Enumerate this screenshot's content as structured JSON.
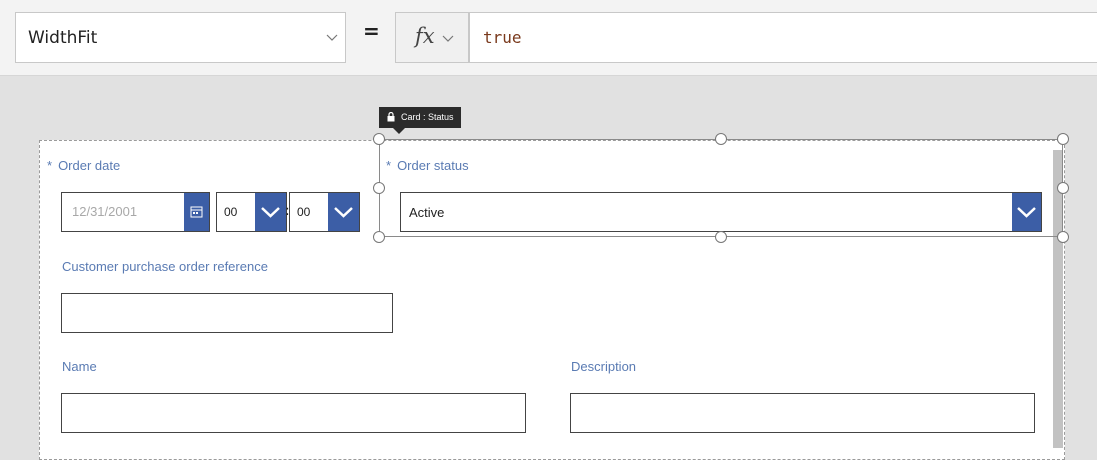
{
  "formula_bar": {
    "property": "WidthFit",
    "equals": "=",
    "fx_label": "fx",
    "formula": "true"
  },
  "tooltip": {
    "text": "Card : Status"
  },
  "form": {
    "order_date": {
      "required_marker": "*",
      "label": "Order date",
      "placeholder": "12/31/2001",
      "hour": "00",
      "minute": "00",
      "separator": ":"
    },
    "order_status": {
      "required_marker": "*",
      "label": "Order status",
      "value": "Active"
    },
    "customer_po": {
      "label": "Customer purchase order reference",
      "value": ""
    },
    "name": {
      "label": "Name",
      "value": ""
    },
    "description": {
      "label": "Description",
      "value": ""
    }
  },
  "colors": {
    "accent": "#3c5ea6",
    "label": "#5a7bb3",
    "formula_text": "#7a3a1d"
  },
  "icons": [
    "chevron-down-icon",
    "calendar-icon",
    "lock-icon"
  ]
}
